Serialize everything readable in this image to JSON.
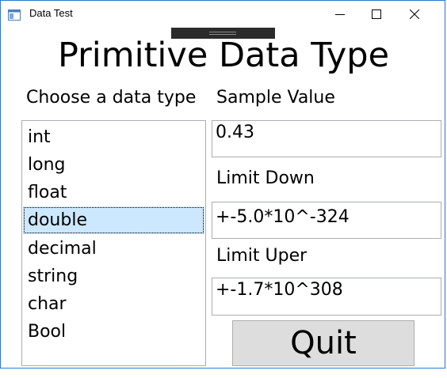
{
  "window": {
    "title": "Data Test",
    "app_icon": "window-app-icon",
    "controls": [
      "minimize-icon",
      "maximize-icon",
      "close-icon"
    ],
    "accent": "#2b78d0"
  },
  "heading": "Primitive Data Type",
  "choose_label": "Choose a data type",
  "data_types": {
    "items": [
      "int",
      "long",
      "float",
      "double",
      "decimal",
      "string",
      "char",
      "Bool"
    ],
    "selected": "double",
    "selected_color": "#cce8ff"
  },
  "sample": {
    "label": "Sample Value",
    "value": "0.43"
  },
  "limit_down": {
    "label": "Limit Down",
    "value": "+-5.0*10^-324"
  },
  "limit_uper": {
    "label": "Limit Uper",
    "value": "+-1.7*10^308"
  },
  "quit_label": "Quit"
}
